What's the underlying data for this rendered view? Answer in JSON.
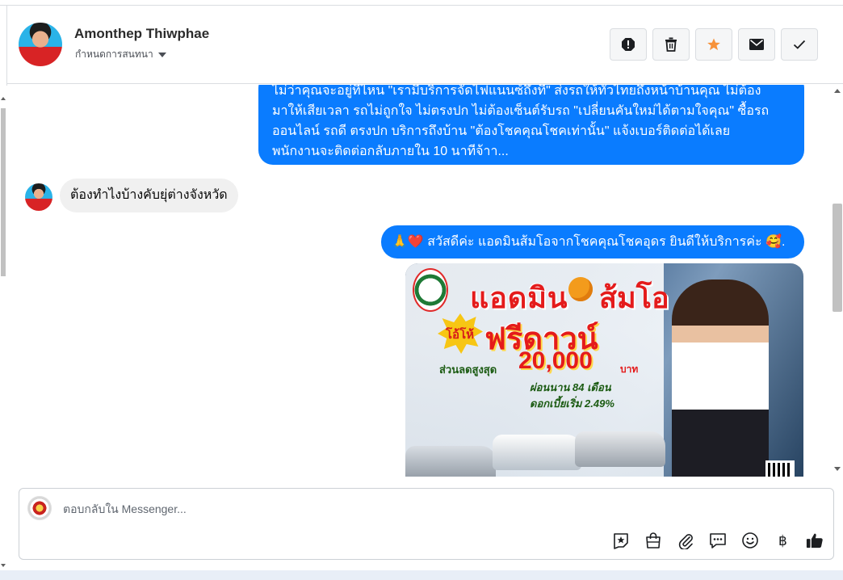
{
  "header": {
    "contact_name": "Amonthep Thiwphae",
    "conversation_setting": "กำหนดการสนทนา",
    "actions": [
      {
        "name": "report-icon",
        "label": "!"
      },
      {
        "name": "trash-icon"
      },
      {
        "name": "star-icon",
        "color": "#f7923a"
      },
      {
        "name": "envelope-icon"
      },
      {
        "name": "check-icon"
      }
    ]
  },
  "messages": [
    {
      "direction": "outgoing",
      "lines": [
        "ไม่ว่าคุณจะอยู่ที่ไหน \"เรามีบริการจัดไฟแนนซ์ถึงที่\" ส่งรถให้ทั่วไทยถึงหน้าบ้านคุณ ไม่ต้อง",
        "มาให้เสียเวลา รถไม่ถูกใจ ไม่ตรงปก ไม่ต้องเซ็นต์รับรถ \"เปลี่ยนคันใหม่ได้ตามใจคุณ\" ซื้อรถ",
        "ออนไลน์ รถดี ตรงปก บริการถึงบ้าน \"ต้องโชคคุณโชคเท่านั้น\" แจ้งเบอร์ติดต่อได้เลย",
        "พนักงานจะติดต่อกลับภายใน 10 นาทีจ้าา..."
      ]
    },
    {
      "direction": "incoming",
      "text": "ต้องทำไงบ้างคับยุ่ต่างจังหวัด"
    },
    {
      "direction": "outgoing",
      "text": "🙏❤️ สวัสดีค่ะ แอดมินส้มโอจากโชคคุณโชคอุดร ยินดีให้บริการค่ะ 🥰."
    }
  ],
  "promo_image": {
    "title_left": "แอดมิน",
    "title_right": "ส้มโอ",
    "burst": "โอ้โห้",
    "headline": "ฟรีดาวน์",
    "discount_label": "ส่วนลดสูงสุด",
    "discount_amount": "20,000",
    "discount_unit": "บาท",
    "installment": "ผ่อนนาน 84 เดือน",
    "interest": "ดอกเบี้ยเริ่ม 2.49%"
  },
  "reply": {
    "placeholder": "ตอบกลับใน Messenger...",
    "tools": [
      "sticker-icon",
      "shop-bag-icon",
      "attachment-icon",
      "saved-reply-icon",
      "emoji-icon",
      "baht-icon",
      "thumbs-up-icon"
    ]
  },
  "colors": {
    "outgoing_bubble": "#0a7cff",
    "incoming_bubble": "#f0f0f0",
    "star": "#f7923a"
  }
}
